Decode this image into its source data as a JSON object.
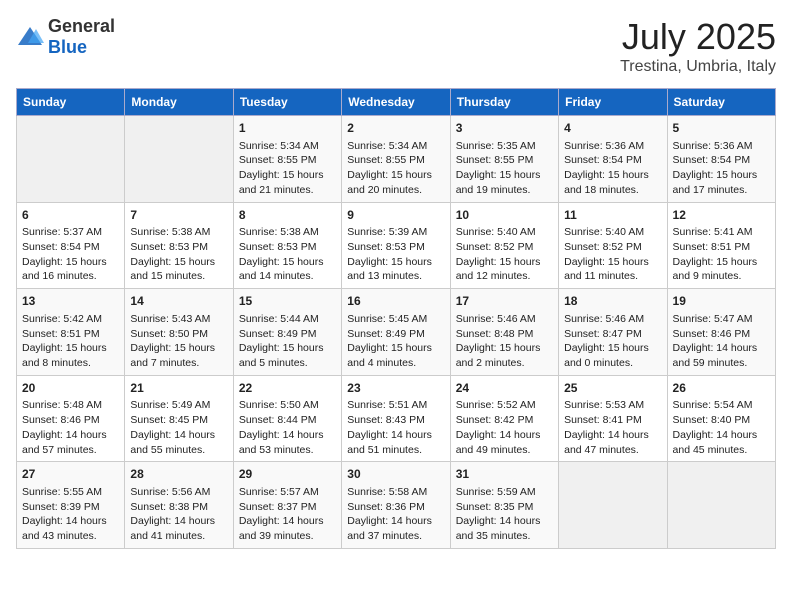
{
  "header": {
    "logo_general": "General",
    "logo_blue": "Blue",
    "title": "July 2025",
    "subtitle": "Trestina, Umbria, Italy"
  },
  "days_of_week": [
    "Sunday",
    "Monday",
    "Tuesday",
    "Wednesday",
    "Thursday",
    "Friday",
    "Saturday"
  ],
  "weeks": [
    [
      {
        "day": "",
        "content": ""
      },
      {
        "day": "",
        "content": ""
      },
      {
        "day": "1",
        "content": "Sunrise: 5:34 AM\nSunset: 8:55 PM\nDaylight: 15 hours and 21 minutes."
      },
      {
        "day": "2",
        "content": "Sunrise: 5:34 AM\nSunset: 8:55 PM\nDaylight: 15 hours and 20 minutes."
      },
      {
        "day": "3",
        "content": "Sunrise: 5:35 AM\nSunset: 8:55 PM\nDaylight: 15 hours and 19 minutes."
      },
      {
        "day": "4",
        "content": "Sunrise: 5:36 AM\nSunset: 8:54 PM\nDaylight: 15 hours and 18 minutes."
      },
      {
        "day": "5",
        "content": "Sunrise: 5:36 AM\nSunset: 8:54 PM\nDaylight: 15 hours and 17 minutes."
      }
    ],
    [
      {
        "day": "6",
        "content": "Sunrise: 5:37 AM\nSunset: 8:54 PM\nDaylight: 15 hours and 16 minutes."
      },
      {
        "day": "7",
        "content": "Sunrise: 5:38 AM\nSunset: 8:53 PM\nDaylight: 15 hours and 15 minutes."
      },
      {
        "day": "8",
        "content": "Sunrise: 5:38 AM\nSunset: 8:53 PM\nDaylight: 15 hours and 14 minutes."
      },
      {
        "day": "9",
        "content": "Sunrise: 5:39 AM\nSunset: 8:53 PM\nDaylight: 15 hours and 13 minutes."
      },
      {
        "day": "10",
        "content": "Sunrise: 5:40 AM\nSunset: 8:52 PM\nDaylight: 15 hours and 12 minutes."
      },
      {
        "day": "11",
        "content": "Sunrise: 5:40 AM\nSunset: 8:52 PM\nDaylight: 15 hours and 11 minutes."
      },
      {
        "day": "12",
        "content": "Sunrise: 5:41 AM\nSunset: 8:51 PM\nDaylight: 15 hours and 9 minutes."
      }
    ],
    [
      {
        "day": "13",
        "content": "Sunrise: 5:42 AM\nSunset: 8:51 PM\nDaylight: 15 hours and 8 minutes."
      },
      {
        "day": "14",
        "content": "Sunrise: 5:43 AM\nSunset: 8:50 PM\nDaylight: 15 hours and 7 minutes."
      },
      {
        "day": "15",
        "content": "Sunrise: 5:44 AM\nSunset: 8:49 PM\nDaylight: 15 hours and 5 minutes."
      },
      {
        "day": "16",
        "content": "Sunrise: 5:45 AM\nSunset: 8:49 PM\nDaylight: 15 hours and 4 minutes."
      },
      {
        "day": "17",
        "content": "Sunrise: 5:46 AM\nSunset: 8:48 PM\nDaylight: 15 hours and 2 minutes."
      },
      {
        "day": "18",
        "content": "Sunrise: 5:46 AM\nSunset: 8:47 PM\nDaylight: 15 hours and 0 minutes."
      },
      {
        "day": "19",
        "content": "Sunrise: 5:47 AM\nSunset: 8:46 PM\nDaylight: 14 hours and 59 minutes."
      }
    ],
    [
      {
        "day": "20",
        "content": "Sunrise: 5:48 AM\nSunset: 8:46 PM\nDaylight: 14 hours and 57 minutes."
      },
      {
        "day": "21",
        "content": "Sunrise: 5:49 AM\nSunset: 8:45 PM\nDaylight: 14 hours and 55 minutes."
      },
      {
        "day": "22",
        "content": "Sunrise: 5:50 AM\nSunset: 8:44 PM\nDaylight: 14 hours and 53 minutes."
      },
      {
        "day": "23",
        "content": "Sunrise: 5:51 AM\nSunset: 8:43 PM\nDaylight: 14 hours and 51 minutes."
      },
      {
        "day": "24",
        "content": "Sunrise: 5:52 AM\nSunset: 8:42 PM\nDaylight: 14 hours and 49 minutes."
      },
      {
        "day": "25",
        "content": "Sunrise: 5:53 AM\nSunset: 8:41 PM\nDaylight: 14 hours and 47 minutes."
      },
      {
        "day": "26",
        "content": "Sunrise: 5:54 AM\nSunset: 8:40 PM\nDaylight: 14 hours and 45 minutes."
      }
    ],
    [
      {
        "day": "27",
        "content": "Sunrise: 5:55 AM\nSunset: 8:39 PM\nDaylight: 14 hours and 43 minutes."
      },
      {
        "day": "28",
        "content": "Sunrise: 5:56 AM\nSunset: 8:38 PM\nDaylight: 14 hours and 41 minutes."
      },
      {
        "day": "29",
        "content": "Sunrise: 5:57 AM\nSunset: 8:37 PM\nDaylight: 14 hours and 39 minutes."
      },
      {
        "day": "30",
        "content": "Sunrise: 5:58 AM\nSunset: 8:36 PM\nDaylight: 14 hours and 37 minutes."
      },
      {
        "day": "31",
        "content": "Sunrise: 5:59 AM\nSunset: 8:35 PM\nDaylight: 14 hours and 35 minutes."
      },
      {
        "day": "",
        "content": ""
      },
      {
        "day": "",
        "content": ""
      }
    ]
  ]
}
